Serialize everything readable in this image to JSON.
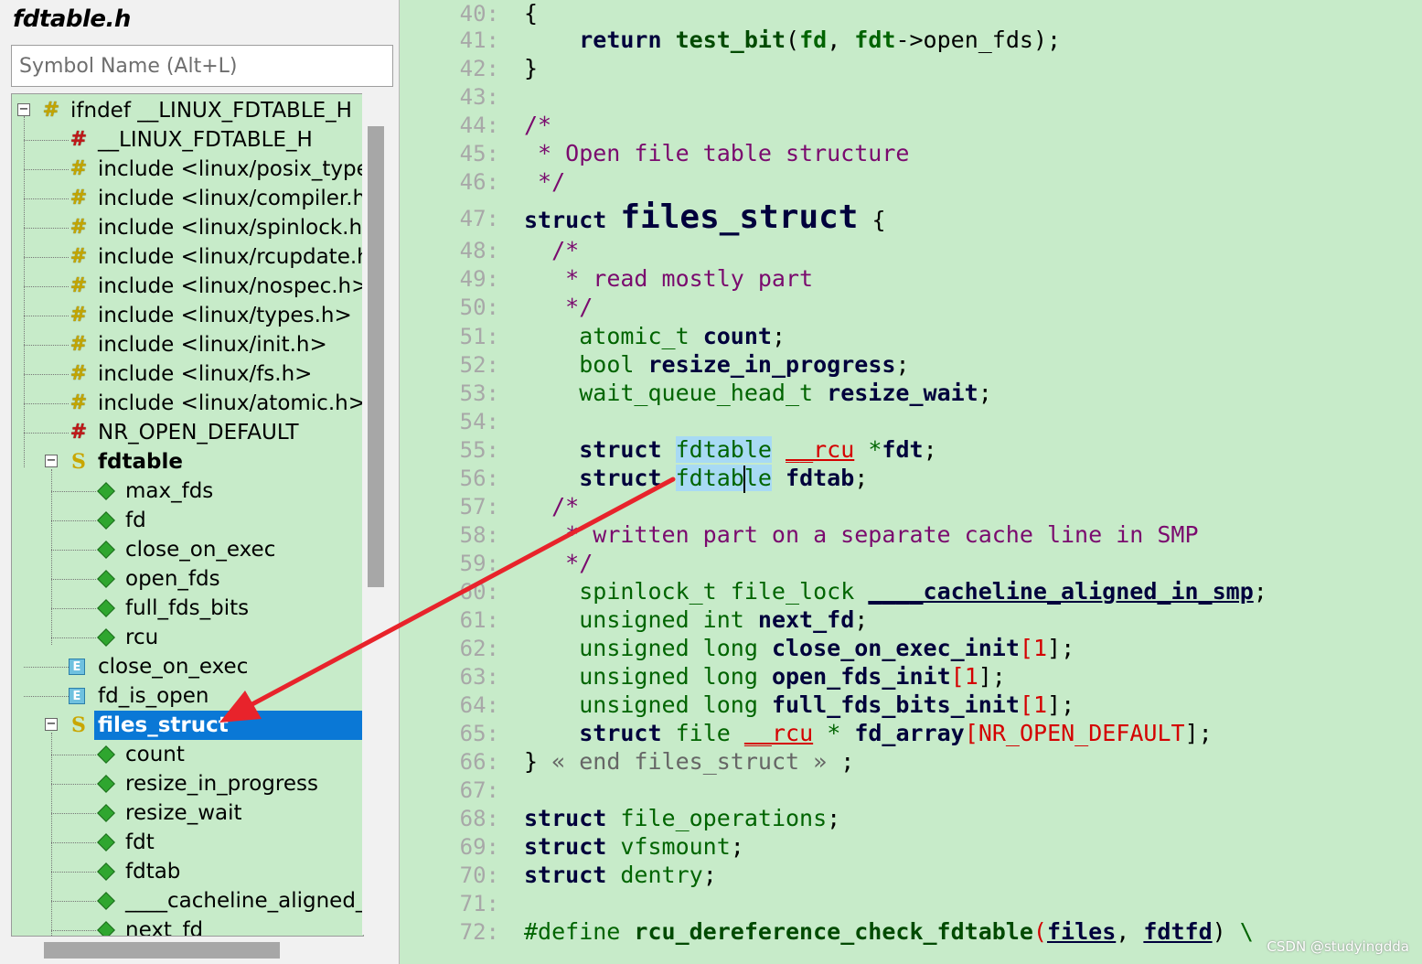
{
  "file_title": "fdtable.h",
  "search": {
    "placeholder": "Symbol Name (Alt+L)"
  },
  "tree": [
    {
      "label": "ifndef __LINUX_FDTABLE_H",
      "icon": "hash-yellow-icon",
      "depth": 0,
      "toggle": "minus"
    },
    {
      "label": "__LINUX_FDTABLE_H",
      "icon": "hash-red-icon",
      "depth": 1
    },
    {
      "label": "include <linux/posix_types.h>",
      "icon": "hash-yellow-icon",
      "depth": 1
    },
    {
      "label": "include <linux/compiler.h>",
      "icon": "hash-yellow-icon",
      "depth": 1
    },
    {
      "label": "include <linux/spinlock.h>",
      "icon": "hash-yellow-icon",
      "depth": 1
    },
    {
      "label": "include <linux/rcupdate.h>",
      "icon": "hash-yellow-icon",
      "depth": 1
    },
    {
      "label": "include <linux/nospec.h>",
      "icon": "hash-yellow-icon",
      "depth": 1
    },
    {
      "label": "include <linux/types.h>",
      "icon": "hash-yellow-icon",
      "depth": 1
    },
    {
      "label": "include <linux/init.h>",
      "icon": "hash-yellow-icon",
      "depth": 1
    },
    {
      "label": "include <linux/fs.h>",
      "icon": "hash-yellow-icon",
      "depth": 1
    },
    {
      "label": "include <linux/atomic.h>",
      "icon": "hash-yellow-icon",
      "depth": 1
    },
    {
      "label": "NR_OPEN_DEFAULT",
      "icon": "hash-red-icon",
      "depth": 1
    },
    {
      "label": "fdtable",
      "icon": "struct-icon",
      "depth": 1,
      "toggle": "minus",
      "bold": true
    },
    {
      "label": "max_fds",
      "icon": "member-icon",
      "depth": 2
    },
    {
      "label": "fd",
      "icon": "member-icon",
      "depth": 2
    },
    {
      "label": "close_on_exec",
      "icon": "member-icon",
      "depth": 2
    },
    {
      "label": "open_fds",
      "icon": "member-icon",
      "depth": 2
    },
    {
      "label": "full_fds_bits",
      "icon": "member-icon",
      "depth": 2
    },
    {
      "label": "rcu",
      "icon": "member-icon",
      "depth": 2
    },
    {
      "label": "close_on_exec",
      "icon": "function-icon",
      "depth": 1
    },
    {
      "label": "fd_is_open",
      "icon": "function-icon",
      "depth": 1
    },
    {
      "label": "files_struct",
      "icon": "struct-icon",
      "depth": 1,
      "toggle": "minus",
      "selected": true
    },
    {
      "label": "count",
      "icon": "member-icon",
      "depth": 2
    },
    {
      "label": "resize_in_progress",
      "icon": "member-icon",
      "depth": 2
    },
    {
      "label": "resize_wait",
      "icon": "member-icon",
      "depth": 2
    },
    {
      "label": "fdt",
      "icon": "member-icon",
      "depth": 2
    },
    {
      "label": "fdtab",
      "icon": "member-icon",
      "depth": 2
    },
    {
      "label": "____cacheline_aligned_in_smp",
      "icon": "member-icon",
      "depth": 2
    },
    {
      "label": "next_fd",
      "icon": "member-icon",
      "depth": 2
    }
  ],
  "line_numbers": [
    "40:",
    "41:",
    "42:",
    "43:",
    "44:",
    "45:",
    "46:",
    "47:",
    "48:",
    "49:",
    "50:",
    "51:",
    "52:",
    "53:",
    "54:",
    "55:",
    "56:",
    "57:",
    "58:",
    "59:",
    "60:",
    "61:",
    "62:",
    "63:",
    "64:",
    "65:",
    "66:",
    "67:",
    "68:",
    "69:",
    "70:",
    "71:",
    "72:"
  ],
  "code": {
    "l40": "{",
    "l41_kw": "return",
    "l41_fn": "test_bit",
    "l41_a": "(",
    "l41_b": "fd",
    "l41_c": ", ",
    "l41_d": "fdt",
    "l41_e": "->open_fds);",
    "l42": "}",
    "l44": "/*",
    "l45": " * Open file table structure",
    "l46": " */",
    "l47_kw": "struct",
    "l47_name": "files_struct",
    "l47_brace": "{",
    "l48": "/*",
    "l49": " * read mostly part",
    "l50": " */",
    "l51_ty": "atomic_t",
    "l51_m": "count",
    "l52_ty": "bool",
    "l52_m": "resize_in_progress",
    "l53_ty": "wait_queue_head_t",
    "l53_m": "resize_wait",
    "l55_kw": "struct",
    "l55_ty": "fdtable",
    "l55_rcu": "__rcu",
    "l55_star": "*",
    "l55_m": "fdt",
    "l56_kw": "struct",
    "l56_ty": "fdtable",
    "l56_m": "fdtab",
    "l57": "/*",
    "l58": " * written part on a separate cache line in SMP",
    "l59": " */",
    "l60_ty": "spinlock_t file_lock",
    "l60_m": "____cacheline_aligned_in_smp",
    "l61_ty": "unsigned int",
    "l61_m": "next_fd",
    "l62_ty": "unsigned long",
    "l62_m": "close_on_exec_init",
    "l63_ty": "unsigned long",
    "l63_m": "open_fds_init",
    "l64_ty": "unsigned long",
    "l64_m": "full_fds_bits_init",
    "one": "1",
    "l65_kw": "struct",
    "l65_ty": "file",
    "l65_rcu": "__rcu",
    "l65_star": "*",
    "l65_m": "fd_array",
    "l65_def": "NR_OPEN_DEFAULT",
    "l66_brace": "}",
    "l66_end": "« end files_struct »",
    "l66_semi": ";",
    "l68_kw": "struct",
    "l68_ty": "file_operations",
    "l69_kw": "struct",
    "l69_ty": "vfsmount",
    "l70_kw": "struct",
    "l70_ty": "dentry",
    "l72_def": "#define",
    "l72_fn": "rcu_dereference_check_fdtable",
    "l72_a": "files",
    "l72_b": "fdtfd",
    "l72_bs": "\\"
  },
  "watermark": "CSDN @studyingdda",
  "colors": {
    "background": "#c7ebc9",
    "selection": "#0a78d6",
    "arrow": "#e8232b",
    "highlight": "#a8daf4"
  }
}
